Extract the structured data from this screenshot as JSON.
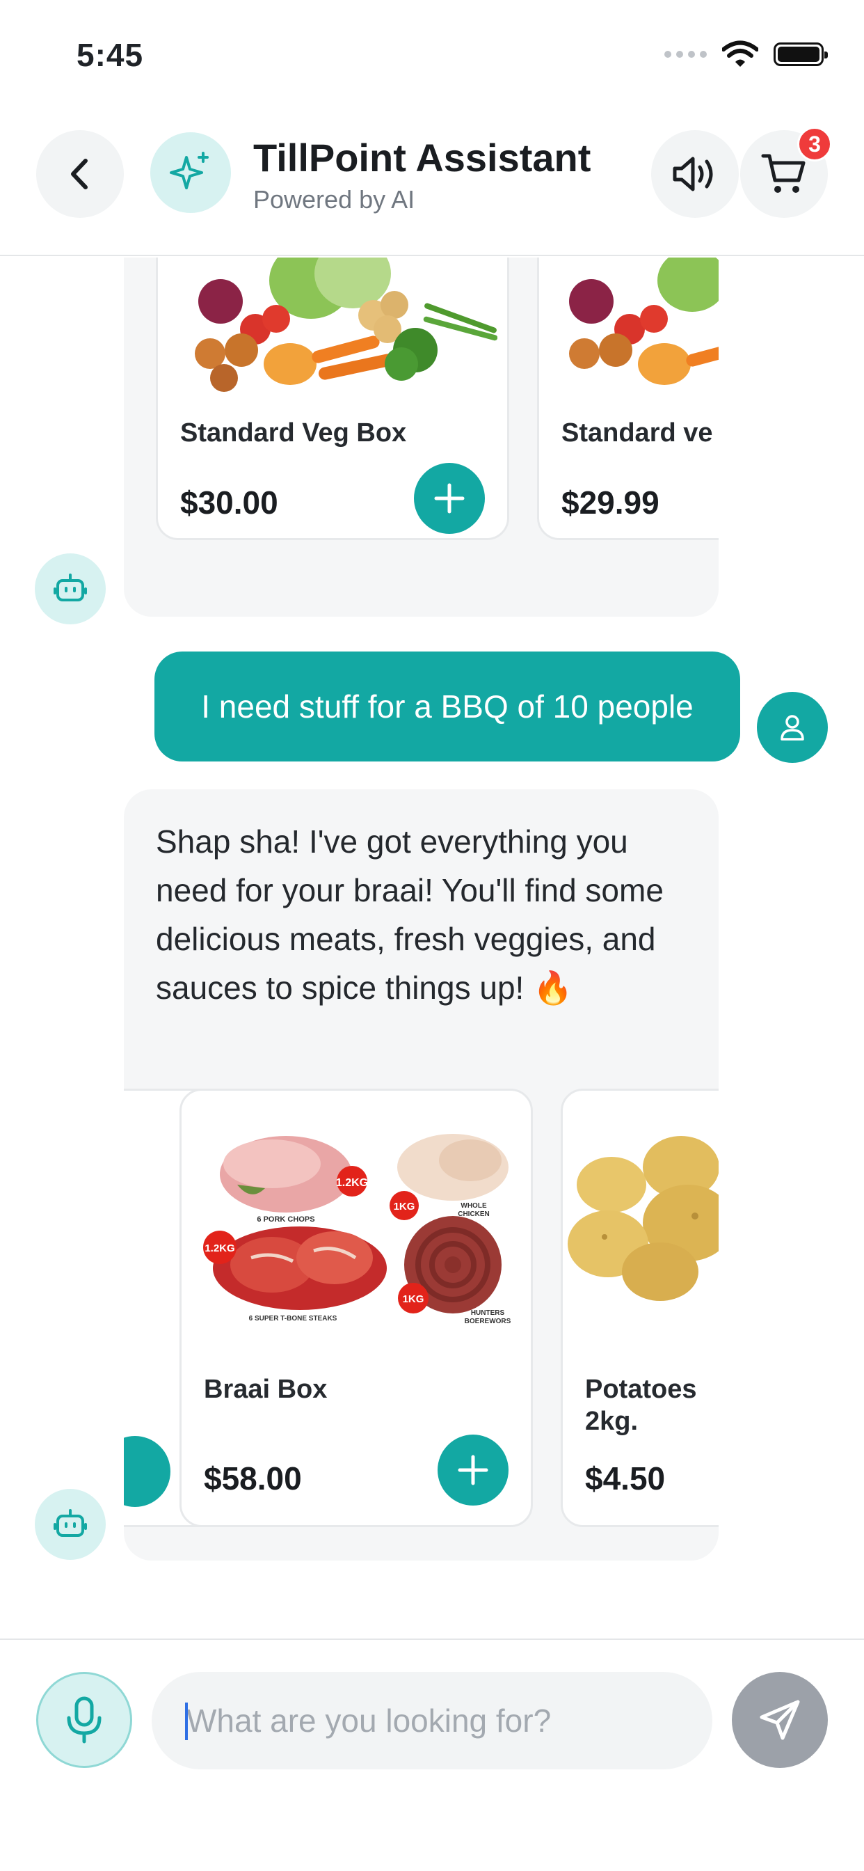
{
  "status_bar": {
    "time": "5:45"
  },
  "header": {
    "title": "TillPoint Assistant",
    "subtitle": "Powered by AI",
    "cart_count": "3"
  },
  "messages": {
    "bot_1": {
      "products": [
        {
          "name": "Standard Veg Box",
          "price": "$30.00"
        },
        {
          "name": "Standard ve",
          "price": "$29.99"
        }
      ]
    },
    "user_1": {
      "text": "I need stuff for a BBQ of 10 people"
    },
    "bot_2": {
      "text": "Shap sha! I've got everything you need for your braai! You'll find some delicious meats, fresh veggies, and sauces to spice things up! 🔥",
      "products": [
        {
          "name": "Braai Box",
          "price": "$58.00",
          "image_labels": {
            "pork_weight": "1.2KG",
            "pork_caption": "6 PORK CHOPS",
            "chicken_weight": "1KG",
            "chicken_caption_1": "WHOLE",
            "chicken_caption_2": "CHICKEN",
            "steak_weight": "1.2KG",
            "steak_caption": "6 SUPER T-BONE STEAKS",
            "wors_weight": "1KG",
            "wors_caption_1": "HUNTERS",
            "wors_caption_2": "BOEREWORS"
          }
        },
        {
          "name_line1": "Potatoes",
          "name_line2": "2kg.",
          "price": "$4.50"
        }
      ]
    }
  },
  "composer": {
    "placeholder": "What are you looking for?"
  },
  "colors": {
    "accent": "#13a8a3",
    "badge": "#ef3b3b",
    "send_disabled": "#9ca1a9"
  }
}
